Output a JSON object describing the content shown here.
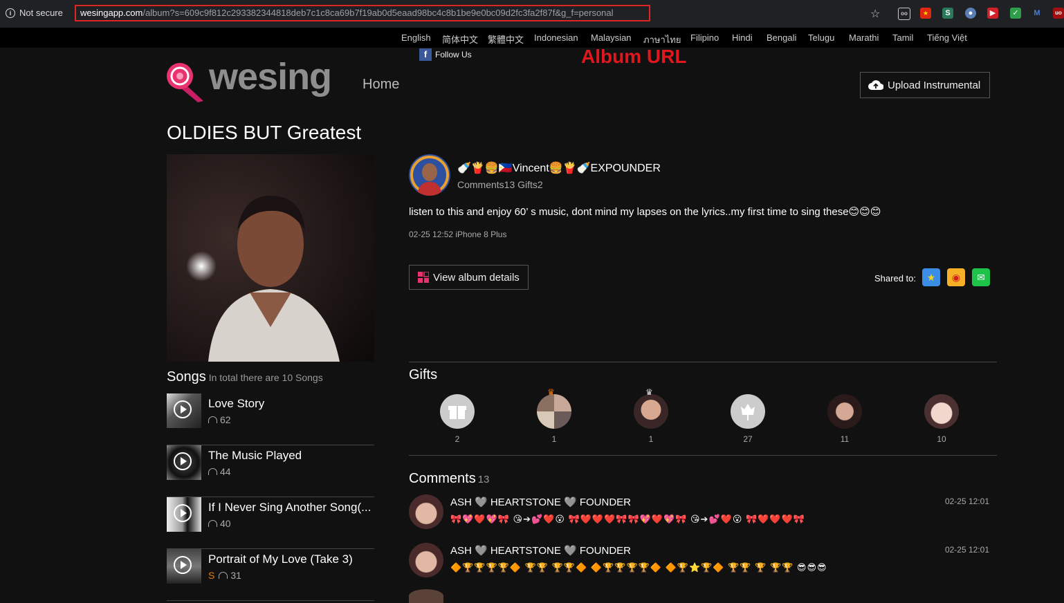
{
  "browser": {
    "security_label": "Not secure",
    "url_host": "wesingapp.com",
    "url_path": "/album?s=609c9f812c293382344818deb7c1c8ca69b7f19ab0d5eaad98bc4c8b1be9e0bc09d2fc3fa2f87f&g_f=personal"
  },
  "languages": [
    "English",
    "简体中文",
    "繁體中文",
    "Indonesian",
    "Malaysian",
    "ภาษาไทย",
    "Filipino",
    "Hindi",
    "Bengali",
    "Telugu",
    "Marathi",
    "Tamil",
    "Tiếng Việt"
  ],
  "follow_label": "Follow Us",
  "annotation": "Album URL",
  "header": {
    "logo_text": "wesing",
    "home_label": "Home",
    "upload_label": "Upload Instrumental"
  },
  "album": {
    "title": "OLDIES BUT Greatest",
    "author": "🍼🍟🍔🇵🇭Vincent🍔🍟🍼EXPOUNDER",
    "stats": "Comments13 Gifts2",
    "description": "listen to this and enjoy 60’  s music, dont mind my lapses on the lyrics..my first time to sing these😊😊😊",
    "meta": "02-25 12:52 iPhone 8 Plus",
    "view_details_label": "View album details",
    "shared_label": "Shared to:"
  },
  "songs": {
    "heading": "Songs",
    "subheading": "In total there are 10 Songs",
    "items": [
      {
        "name": "Love Story",
        "plays": "62",
        "badge": ""
      },
      {
        "name": "The Music Played",
        "plays": "44",
        "badge": ""
      },
      {
        "name": "If I Never Sing Another Song(...",
        "plays": "40",
        "badge": ""
      },
      {
        "name": "Portrait of My Love (Take 3)",
        "plays": "31",
        "badge": "S"
      }
    ]
  },
  "gifts": {
    "heading": "Gifts",
    "items": [
      {
        "count": "2",
        "color": "#cfcfcf"
      },
      {
        "count": "1",
        "color": "#b8a090"
      },
      {
        "count": "1",
        "color": "#c09080"
      },
      {
        "count": "27",
        "color": "#cfcfcf"
      },
      {
        "count": "11",
        "color": "#6a5048"
      },
      {
        "count": "10",
        "color": "#d8b8a8"
      }
    ]
  },
  "comments": {
    "heading": "Comments",
    "count": "13",
    "items": [
      {
        "author": "ASH 🩶 HEARTSTONE 🩶 FOUNDER",
        "time": "02-25 12:01",
        "text": "🎀💖❤️💖🎀 😘➔💕❤️😮 🎀❤️❤️❤️🎀🎀💖❤️💖🎀 😘➔💕❤️😮 🎀❤️❤️❤️🎀"
      },
      {
        "author": "ASH 🩶 HEARTSTONE 🩶 FOUNDER",
        "time": "02-25 12:01",
        "text": "🔶🏆🏆🏆🏆🔶 🏆🏆 🏆🏆🔶 🔶🏆🏆🏆🏆🔶 🔶🏆⭐🏆🔶 🏆🏆 🏆 🏆🏆 😎😎😎"
      }
    ]
  },
  "colors": {
    "accent": "#e02424",
    "brand_pink": "#e8336f",
    "background": "#111111"
  }
}
